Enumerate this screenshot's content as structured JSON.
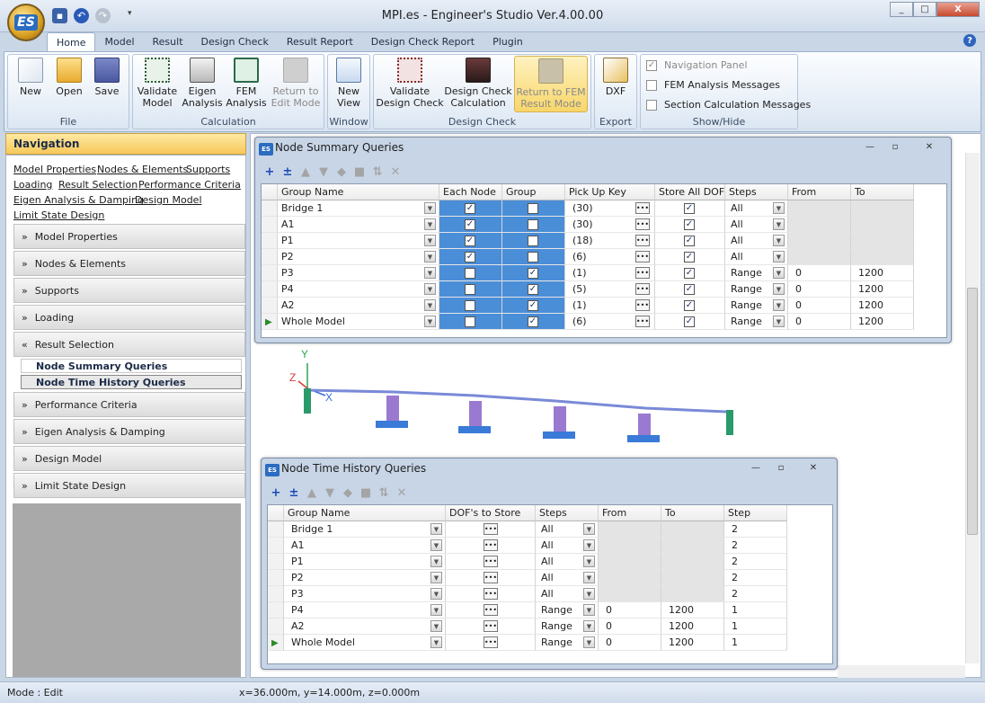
{
  "app": {
    "title": "MPI.es - Engineer's Studio Ver.4.00.00",
    "logo": "ES"
  },
  "quick_access": [
    "save-icon",
    "undo-icon",
    "redo-icon",
    "customize-icon"
  ],
  "window_buttons": [
    "_",
    "□",
    "X"
  ],
  "ribbon_tabs": [
    "Home",
    "Model",
    "Result",
    "Design Check",
    "Result Report",
    "Design Check Report",
    "Plugin"
  ],
  "ribbon": {
    "file": {
      "label": "File",
      "new": "New",
      "open": "Open",
      "save": "Save"
    },
    "calculation": {
      "label": "Calculation",
      "validate": "Validate\nModel",
      "eigen": "Eigen\nAnalysis",
      "fem": "FEM\nAnalysis",
      "return_edit": "Return to\nEdit Mode"
    },
    "window": {
      "label": "Window",
      "new_view": "New\nView"
    },
    "design_check": {
      "label": "Design Check",
      "validate": "Validate\nDesign Check",
      "calc": "Design Check\nCalculation",
      "return_fem": "Return to FEM\nResult Mode"
    },
    "export": {
      "label": "Export",
      "dxf": "DXF"
    },
    "showhide": {
      "label": "Show/Hide",
      "nav_panel": "Navigation Panel",
      "fem_msgs": "FEM Analysis Messages",
      "section_msgs": "Section Calculation Messages"
    }
  },
  "navigation": {
    "header": "Navigation",
    "links": [
      "Model Properties",
      "Nodes & Elements",
      "Supports",
      "Loading",
      "Result Selection",
      "Performance Criteria",
      "Eigen Analysis & Damping",
      "Design Model",
      "Limit State Design"
    ],
    "sections": [
      "Model Properties",
      "Nodes & Elements",
      "Supports",
      "Loading",
      "Result Selection",
      "Performance Criteria",
      "Eigen Analysis & Damping",
      "Design Model",
      "Limit State Design"
    ],
    "subitems": [
      "Node Summary Queries",
      "Node Time History Queries"
    ]
  },
  "node_summary": {
    "title": "Node Summary Queries",
    "columns": [
      "Group Name",
      "Each Node",
      "Group",
      "Pick Up Key",
      "Store All DOF",
      "Steps",
      "From",
      "To"
    ],
    "rows": [
      {
        "name": "Bridge 1",
        "each": true,
        "group": false,
        "key": "(30)",
        "store": true,
        "steps": "All",
        "from": "",
        "to": ""
      },
      {
        "name": "A1",
        "each": true,
        "group": false,
        "key": "(30)",
        "store": true,
        "steps": "All",
        "from": "",
        "to": ""
      },
      {
        "name": "P1",
        "each": true,
        "group": false,
        "key": "(18)",
        "store": true,
        "steps": "All",
        "from": "",
        "to": ""
      },
      {
        "name": "P2",
        "each": true,
        "group": false,
        "key": "(6)",
        "store": true,
        "steps": "All",
        "from": "",
        "to": ""
      },
      {
        "name": "P3",
        "each": false,
        "group": true,
        "key": "(1)",
        "store": true,
        "steps": "Range",
        "from": "0",
        "to": "1200"
      },
      {
        "name": "P4",
        "each": false,
        "group": true,
        "key": "(5)",
        "store": true,
        "steps": "Range",
        "from": "0",
        "to": "1200"
      },
      {
        "name": "A2",
        "each": false,
        "group": true,
        "key": "(1)",
        "store": true,
        "steps": "Range",
        "from": "0",
        "to": "1200"
      },
      {
        "name": "Whole Model",
        "each": false,
        "group": true,
        "key": "(6)",
        "store": true,
        "steps": "Range",
        "from": "0",
        "to": "1200"
      }
    ]
  },
  "node_time_history": {
    "title": "Node Time History Queries",
    "columns": [
      "Group Name",
      "DOF's to Store",
      "Steps",
      "From",
      "To",
      "Step"
    ],
    "rows": [
      {
        "name": "Bridge 1",
        "steps": "All",
        "from": "",
        "to": "",
        "step": "2"
      },
      {
        "name": "A1",
        "steps": "All",
        "from": "",
        "to": "",
        "step": "2"
      },
      {
        "name": "P1",
        "steps": "All",
        "from": "",
        "to": "",
        "step": "2"
      },
      {
        "name": "P2",
        "steps": "All",
        "from": "",
        "to": "",
        "step": "2"
      },
      {
        "name": "P3",
        "steps": "All",
        "from": "",
        "to": "",
        "step": "2"
      },
      {
        "name": "P4",
        "steps": "Range",
        "from": "0",
        "to": "1200",
        "step": "1"
      },
      {
        "name": "A2",
        "steps": "Range",
        "from": "0",
        "to": "1200",
        "step": "1"
      },
      {
        "name": "Whole Model",
        "steps": "Range",
        "from": "0",
        "to": "1200",
        "step": "1"
      }
    ]
  },
  "axes": {
    "y": "Y",
    "z": "Z",
    "x": "X"
  },
  "status": {
    "mode": "Mode : Edit",
    "coords": "x=36.000m, y=14.000m, z=0.000m"
  }
}
